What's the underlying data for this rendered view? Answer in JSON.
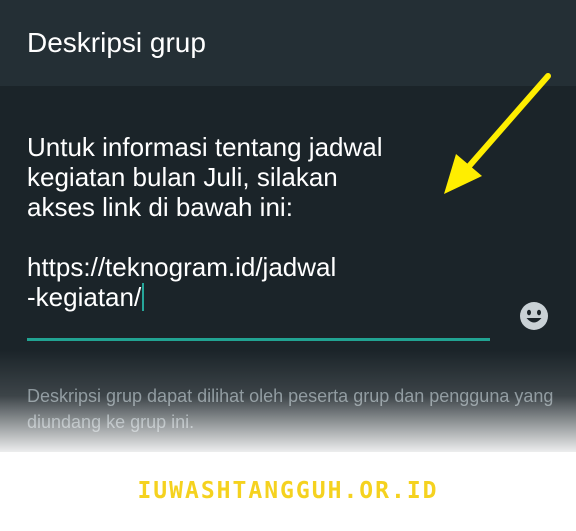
{
  "header": {
    "title": "Deskripsi grup"
  },
  "editor": {
    "line1": "Untuk informasi tentang jadwal",
    "line2": "kegiatan bulan Juli, silakan",
    "line3": "akses link di bawah ini:",
    "line4": "https://teknogram.id/jadwal",
    "line5": "-kegiatan/"
  },
  "emoji_button": {
    "icon": "emoji-smiley-icon"
  },
  "helper_text": "Deskripsi grup dapat dilihat oleh peserta grup dan pengguna yang diundang ke grup ini.",
  "annotation": {
    "icon": "yellow-arrow-icon",
    "color": "#ffee00"
  },
  "watermark": "IUWASHTANGGUH.OR.ID",
  "colors": {
    "background": "#1b2429",
    "header": "#242f35",
    "accent": "#21a392",
    "watermark": "#f5d21f"
  }
}
